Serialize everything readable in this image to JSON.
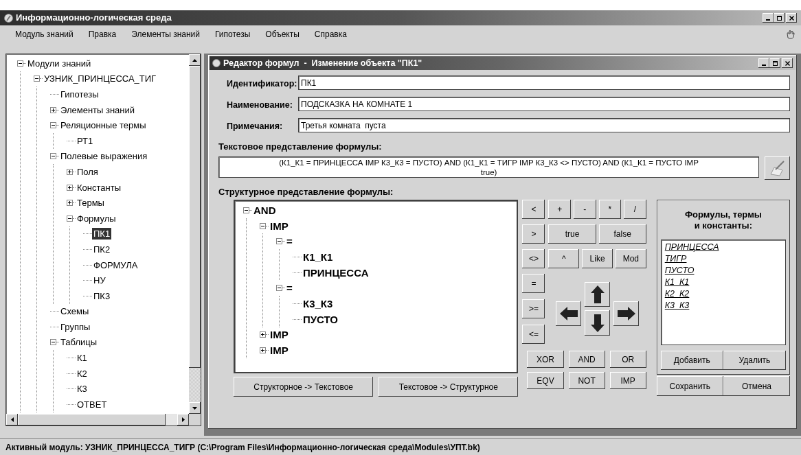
{
  "window": {
    "title": "Информационно-логическая среда"
  },
  "menu": [
    "Модуль знаний",
    "Правка",
    "Элементы знаний",
    "Гипотезы",
    "Объекты",
    "Справка"
  ],
  "tree": [
    {
      "label": "Модули знаний",
      "selected": false,
      "expanded": true,
      "children": [
        {
          "label": "УЗНИК_ПРИНЦЕССА_ТИГ",
          "selected": false,
          "expanded": true,
          "children": [
            {
              "label": "Гипотезы",
              "selected": false
            },
            {
              "label": "Элементы знаний",
              "selected": false,
              "expanded": false
            },
            {
              "label": "Реляционные термы",
              "selected": false,
              "expanded": true,
              "children": [
                {
                  "label": "РТ1",
                  "selected": false
                }
              ]
            },
            {
              "label": "Полевые выражения",
              "selected": false,
              "expanded": true,
              "children": [
                {
                  "label": "Поля",
                  "selected": false,
                  "expanded": false
                },
                {
                  "label": "Константы",
                  "selected": false,
                  "expanded": false
                },
                {
                  "label": "Термы",
                  "selected": false,
                  "expanded": false
                },
                {
                  "label": "Формулы",
                  "selected": false,
                  "expanded": true,
                  "children": [
                    {
                      "label": "ПК1",
                      "selected": true
                    },
                    {
                      "label": "ПК2",
                      "selected": false
                    },
                    {
                      "label": "ФОРМУЛА",
                      "selected": false
                    },
                    {
                      "label": "НУ",
                      "selected": false
                    },
                    {
                      "label": "ПК3",
                      "selected": false
                    }
                  ]
                }
              ]
            },
            {
              "label": "Схемы",
              "selected": false
            },
            {
              "label": "Группы",
              "selected": false
            },
            {
              "label": "Таблицы",
              "selected": false,
              "expanded": true,
              "children": [
                {
                  "label": "К1",
                  "selected": false
                },
                {
                  "label": "К2",
                  "selected": false
                },
                {
                  "label": "К3",
                  "selected": false
                },
                {
                  "label": "ОТВЕТ",
                  "selected": false
                }
              ]
            }
          ]
        }
      ]
    }
  ],
  "editor": {
    "title": "Редактор формул  -  Изменение объекта \"ПК1\"",
    "fields": [
      {
        "label": "Идентификатор:",
        "value": "ПК1"
      },
      {
        "label": "Наименование:",
        "value": "ПОДСКАЗКА НА КОМНАТЕ 1"
      },
      {
        "label": "Примечания:",
        "value": "Третья комната  пуста"
      }
    ],
    "text_heading": "Текстовое представление формулы:",
    "formula_text": "(К1_К1 = ПРИНЦЕССА IMP К3_К3 = ПУСТО) AND (К1_К1 = ТИГР IMP К3_К3 <> ПУСТО) AND (К1_К1 = ПУСТО IMP\ntrue)",
    "structure_heading": "Структурное представление формулы:",
    "formula_tree": [
      {
        "label": "AND",
        "expanded": true,
        "children": [
          {
            "label": "IMP",
            "expanded": true,
            "children": [
              {
                "label": "=",
                "expanded": true,
                "children": [
                  {
                    "label": "К1_К1"
                  },
                  {
                    "label": "ПРИНЦЕССА"
                  }
                ]
              },
              {
                "label": "=",
                "expanded": true,
                "children": [
                  {
                    "label": "К3_К3"
                  },
                  {
                    "label": "ПУСТО"
                  }
                ]
              }
            ]
          },
          {
            "label": "IMP",
            "expanded": false
          },
          {
            "label": "IMP",
            "expanded": false
          }
        ]
      }
    ],
    "convert_buttons": [
      "Структорное -> Текстовое",
      "Текстовое -> Структурное"
    ],
    "operator_rows": [
      [
        "<",
        "+",
        "-",
        "*",
        "/"
      ],
      [
        ">",
        "true",
        "false"
      ],
      [
        "<>",
        "^",
        "Like",
        "Mod"
      ]
    ],
    "comparison_buttons": [
      "=",
      ">=",
      "<="
    ],
    "logic_rows": [
      [
        "XOR",
        "AND",
        "OR"
      ],
      [
        "EQV",
        "NOT",
        "IMP"
      ]
    ],
    "library": {
      "title": "Формулы, термы\nи константы:",
      "items": [
        "ПРИНЦЕССА",
        "ТИГР",
        "ПУСТО",
        "К1_К1",
        "К2_К2",
        "К3_К3"
      ],
      "buttons": [
        "Добавить",
        "Удалить"
      ]
    },
    "dialog_buttons": [
      "Сохранить",
      "Отмена"
    ]
  },
  "status_bar": "Активный модуль: УЗНИК_ПРИНЦЕССА_ТИГР (C:\\Program Files\\Информационно-логическая среда\\Modules\\УПТ.bk)"
}
